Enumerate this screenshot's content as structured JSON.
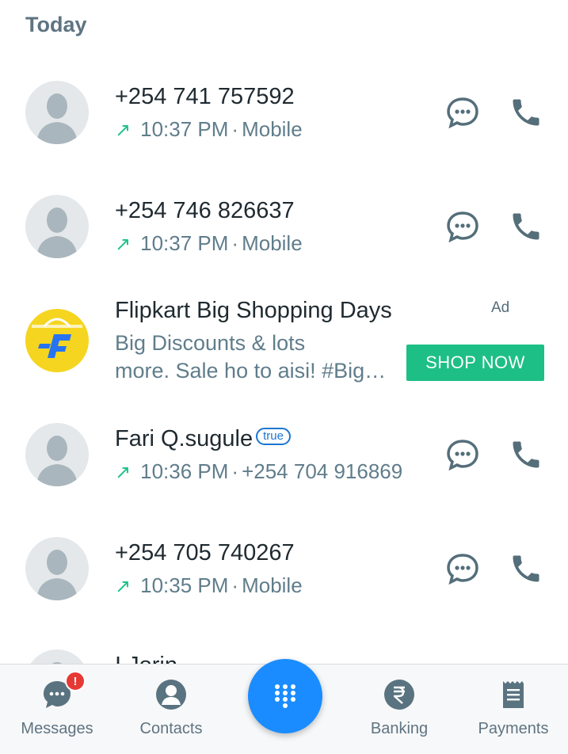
{
  "section": {
    "title": "Today"
  },
  "calls": [
    {
      "name": "+254 741 757592",
      "time": "10:37 PM",
      "detail": "Mobile",
      "direction_icon": "outgoing-arrow-icon"
    },
    {
      "name": "+254 746 826637",
      "time": "10:37 PM",
      "detail": "Mobile",
      "direction_icon": "outgoing-arrow-icon"
    },
    {
      "name": "Fari Q.sugule",
      "badge": "true",
      "time": "10:36 PM",
      "detail": "+254 704 916869",
      "direction_icon": "outgoing-arrow-icon"
    },
    {
      "name": "+254 705 740267",
      "time": "10:35 PM",
      "detail": "Mobile",
      "direction_icon": "outgoing-arrow-icon"
    },
    {
      "name": "I Jorin"
    }
  ],
  "ad": {
    "label": "Ad",
    "title": "Flipkart Big Shopping Days",
    "desc_line1": "Big Discounts & lots",
    "desc_line2": "more. Sale ho to aisi! #BigS…",
    "cta": "SHOP NOW"
  },
  "nav": {
    "messages": "Messages",
    "messages_badge": "!",
    "contacts": "Contacts",
    "banking": "Banking",
    "payments": "Payments"
  },
  "colors": {
    "accent": "#1a8cff",
    "cta": "#1dbf86",
    "icon": "#546e7a",
    "arrow": "#1ec38a",
    "badge": "#e53935"
  }
}
